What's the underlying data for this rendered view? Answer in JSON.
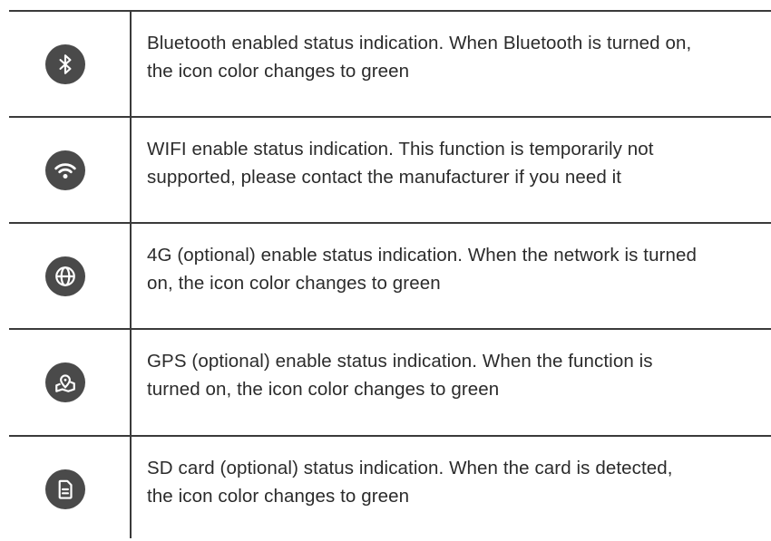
{
  "rows": [
    {
      "icon": "bluetooth-icon",
      "line1": "Bluetooth enabled status indication. When Bluetooth is turned on,",
      "line2": "the icon color changes to green"
    },
    {
      "icon": "wifi-icon",
      "line1": "WIFI enable status indication. This function is temporarily not",
      "line2": "supported, please contact the manufacturer if you need it"
    },
    {
      "icon": "globe-icon",
      "line1": "4G (optional) enable status indication. When the network is turned",
      "line2": "on, the icon color changes to green"
    },
    {
      "icon": "map-pin-icon",
      "line1": "GPS (optional) enable status indication. When the function is",
      "line2": "turned on, the icon color changes to green"
    },
    {
      "icon": "sd-card-icon",
      "line1": "SD card (optional) status indication. When the card is detected,",
      "line2": "the icon color changes to green"
    }
  ],
  "colors": {
    "icon_bg": "#4a4a4a",
    "icon_fg": "#ffffff",
    "text": "#2b2b2b",
    "rule": "#3a3a3a"
  }
}
